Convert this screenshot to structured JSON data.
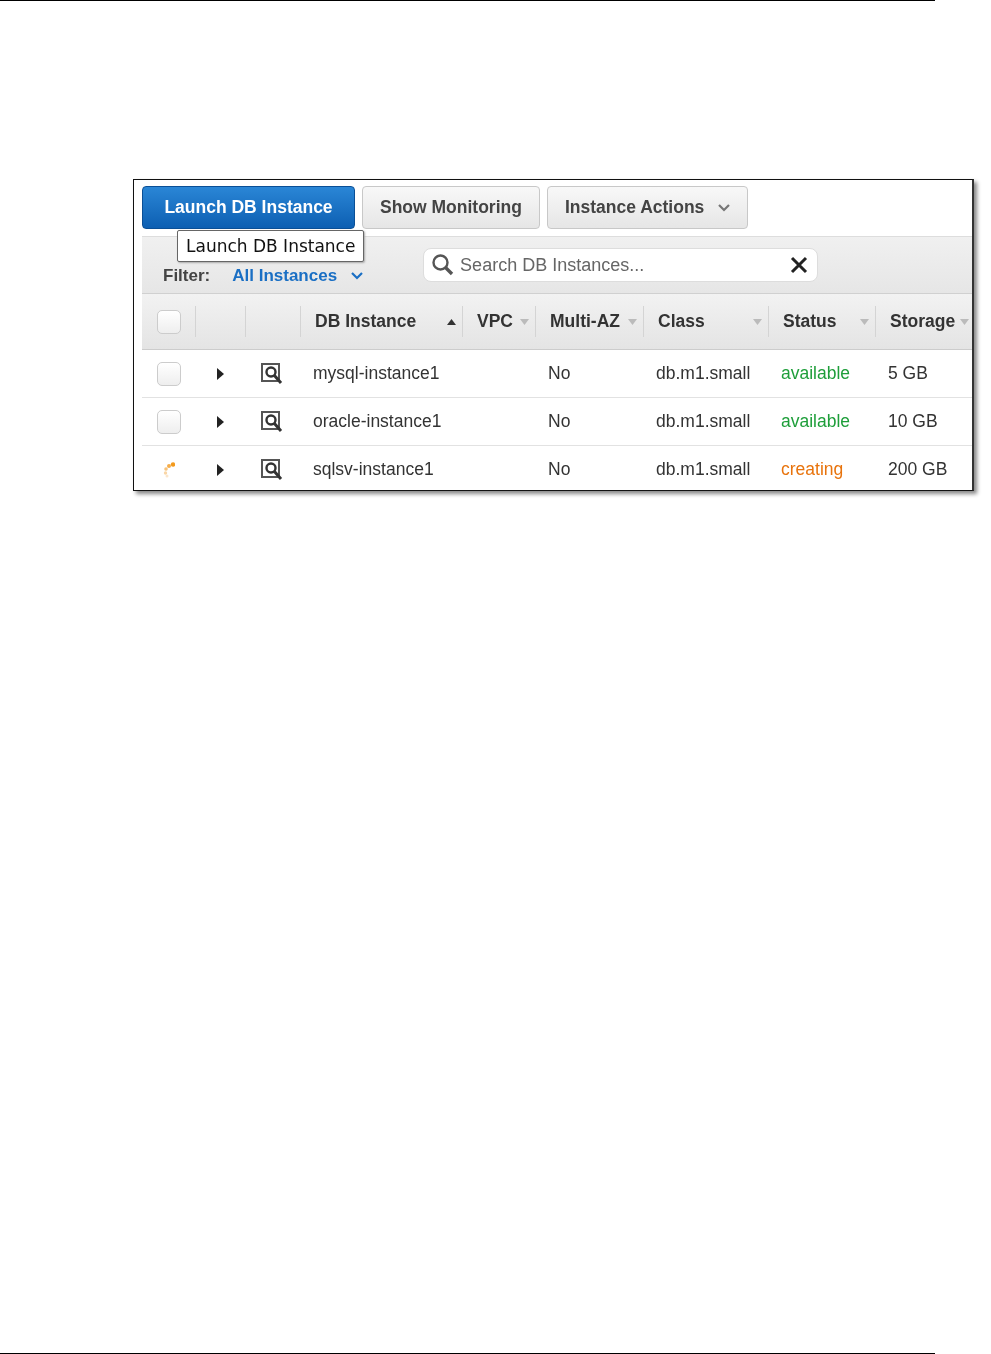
{
  "toolbar": {
    "buttons": [
      {
        "label": "Launch DB Instance",
        "kind": "primary",
        "has_menu": false
      },
      {
        "label": "Show Monitoring",
        "kind": "secondary",
        "has_menu": false
      },
      {
        "label": "Instance Actions",
        "kind": "secondary",
        "has_menu": true
      }
    ]
  },
  "tooltip": {
    "text": "Launch DB Instance"
  },
  "filter": {
    "label": "Filter:",
    "value": "All Instances"
  },
  "search": {
    "placeholder": "Search DB Instances..."
  },
  "table": {
    "select_all": {
      "checked": false
    },
    "columns": [
      {
        "label": "DB Instance",
        "sorted": true
      },
      {
        "label": "VPC",
        "sorted": false
      },
      {
        "label": "Multi-AZ",
        "sorted": false
      },
      {
        "label": "Class",
        "sorted": false
      },
      {
        "label": "Status",
        "sorted": false
      },
      {
        "label": "Storage",
        "sorted": false
      }
    ],
    "rows": [
      {
        "kind": "checkbox",
        "checked": false,
        "name": "mysql-instance1",
        "multi_az": "No",
        "class": "db.m1.small",
        "status": {
          "text": "available",
          "color": "#1e9e3a"
        },
        "storage": "5 GB"
      },
      {
        "kind": "checkbox",
        "checked": false,
        "name": "oracle-instance1",
        "multi_az": "No",
        "class": "db.m1.small",
        "status": {
          "text": "available",
          "color": "#1e9e3a"
        },
        "storage": "10 GB"
      },
      {
        "kind": "spinner",
        "name": "sqlsv-instance1",
        "multi_az": "No",
        "class": "db.m1.small",
        "status": {
          "text": "creating",
          "color": "#e8730c"
        },
        "storage": "200 GB"
      }
    ]
  }
}
